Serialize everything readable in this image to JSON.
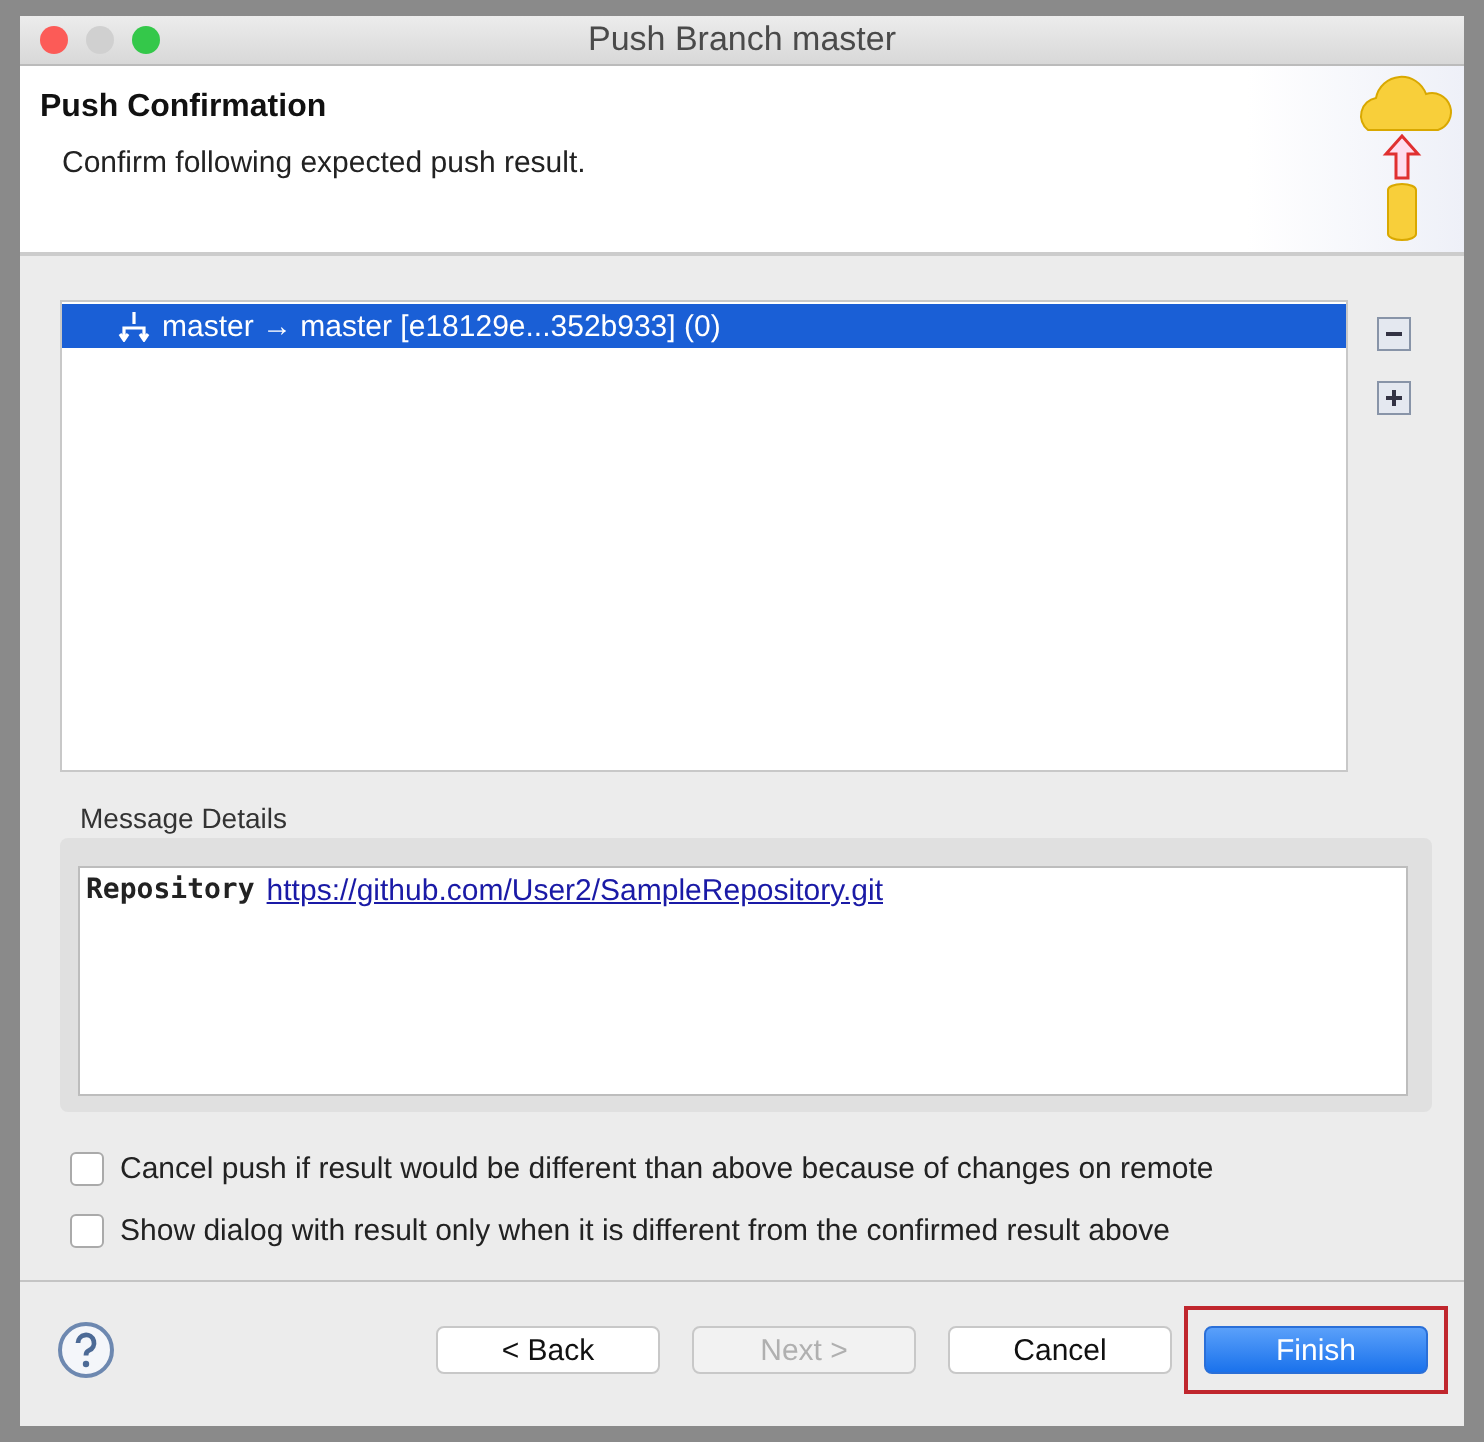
{
  "window": {
    "title": "Push Branch master"
  },
  "header": {
    "title": "Push Confirmation",
    "description": "Confirm following expected push result."
  },
  "results": [
    {
      "text": "master → master [e18129e...352b933] (0)",
      "selected": true
    }
  ],
  "message_details": {
    "label": "Message Details",
    "key": "Repository",
    "link": "https://github.com/User2/SampleRepository.git"
  },
  "options": [
    {
      "label": "Cancel push if result would be different than above because of changes on remote",
      "checked": false
    },
    {
      "label": "Show dialog with result only when it is different from the confirmed result above",
      "checked": false
    }
  ],
  "buttons": [
    {
      "label": "< Back",
      "disabled": false,
      "default": false,
      "highlighted": false
    },
    {
      "label": "Next >",
      "disabled": true,
      "default": false,
      "highlighted": false
    },
    {
      "label": "Cancel",
      "disabled": false,
      "default": false,
      "highlighted": false
    },
    {
      "label": "Finish",
      "disabled": false,
      "default": true,
      "highlighted": true
    }
  ]
}
